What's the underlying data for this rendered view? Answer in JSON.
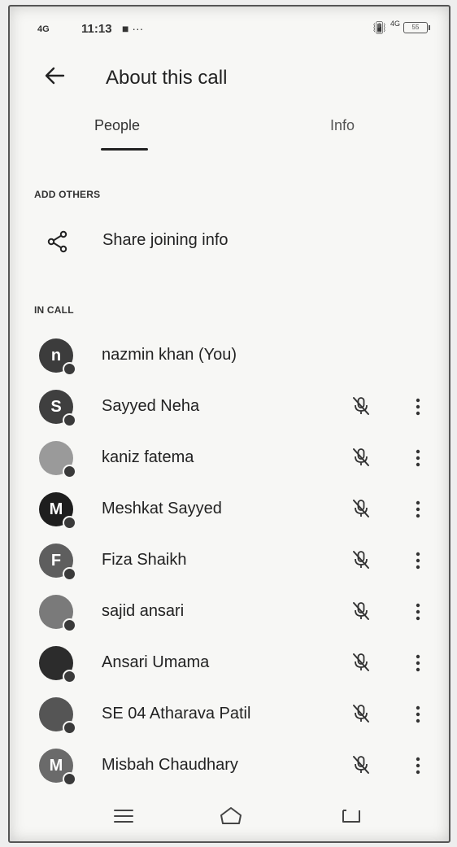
{
  "status_bar": {
    "signal": "4G",
    "time": "11:13",
    "extra": "■ ···",
    "net": "4G",
    "battery": "55"
  },
  "header": {
    "title": "About this call"
  },
  "tabs": [
    {
      "label": "People",
      "active": true
    },
    {
      "label": "Info",
      "active": false
    }
  ],
  "add_others": {
    "section_label": "ADD OTHERS",
    "share_label": "Share joining info",
    "icon": "share-icon"
  },
  "in_call": {
    "section_label": "IN CALL",
    "participants": [
      {
        "name": "nazmin khan (You)",
        "initial": "n",
        "avatar_color": "#3c3c3c",
        "muted_icon": false
      },
      {
        "name": "Sayyed Neha",
        "initial": "S",
        "avatar_color": "#3f3f3f",
        "muted_icon": true
      },
      {
        "name": "kaniz fatema",
        "initial": "",
        "avatar_color": "#9a9a9a",
        "muted_icon": true
      },
      {
        "name": "Meshkat Sayyed",
        "initial": "M",
        "avatar_color": "#1e1e1e",
        "muted_icon": true
      },
      {
        "name": "Fiza Shaikh",
        "initial": "F",
        "avatar_color": "#5e5e5e",
        "muted_icon": true
      },
      {
        "name": "sajid ansari",
        "initial": "",
        "avatar_color": "#7a7a7a",
        "muted_icon": true
      },
      {
        "name": "Ansari Umama",
        "initial": "",
        "avatar_color": "#2c2c2c",
        "muted_icon": true
      },
      {
        "name": "SE 04 Atharava Patil",
        "initial": "",
        "avatar_color": "#555555",
        "muted_icon": true
      },
      {
        "name": "Misbah Chaudhary",
        "initial": "M",
        "avatar_color": "#6a6a6a",
        "muted_icon": true
      }
    ]
  },
  "nav_bar": {
    "buttons": [
      "menu-icon",
      "home-icon",
      "back-icon"
    ]
  }
}
